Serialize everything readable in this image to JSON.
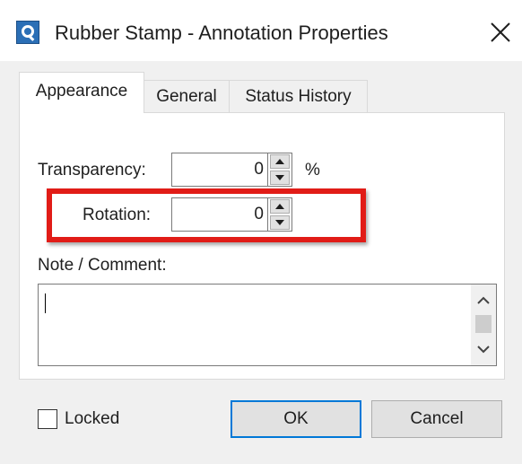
{
  "window": {
    "title": "Rubber Stamp - Annotation Properties"
  },
  "tabs": [
    {
      "label": "Appearance",
      "active": true
    },
    {
      "label": "General",
      "active": false
    },
    {
      "label": "Status History",
      "active": false
    }
  ],
  "appearance": {
    "transparency_label": "Transparency:",
    "transparency_value": "0",
    "transparency_unit": "%",
    "rotation_label": "Rotation:",
    "rotation_value": "0",
    "note_label": "Note / Comment:",
    "note_value": ""
  },
  "footer": {
    "locked_label": "Locked",
    "locked_checked": false,
    "ok_label": "OK",
    "cancel_label": "Cancel"
  },
  "colors": {
    "highlight": "#e11c17",
    "accent": "#0078d7",
    "app_icon": "#2b6fb6"
  },
  "icons": {
    "app": "app-icon",
    "close": "close-icon",
    "spin_up": "spin-up-arrow-icon",
    "spin_down": "spin-down-arrow-icon",
    "scroll_up": "scroll-up-arrow-icon",
    "scroll_down": "scroll-down-arrow-icon"
  }
}
